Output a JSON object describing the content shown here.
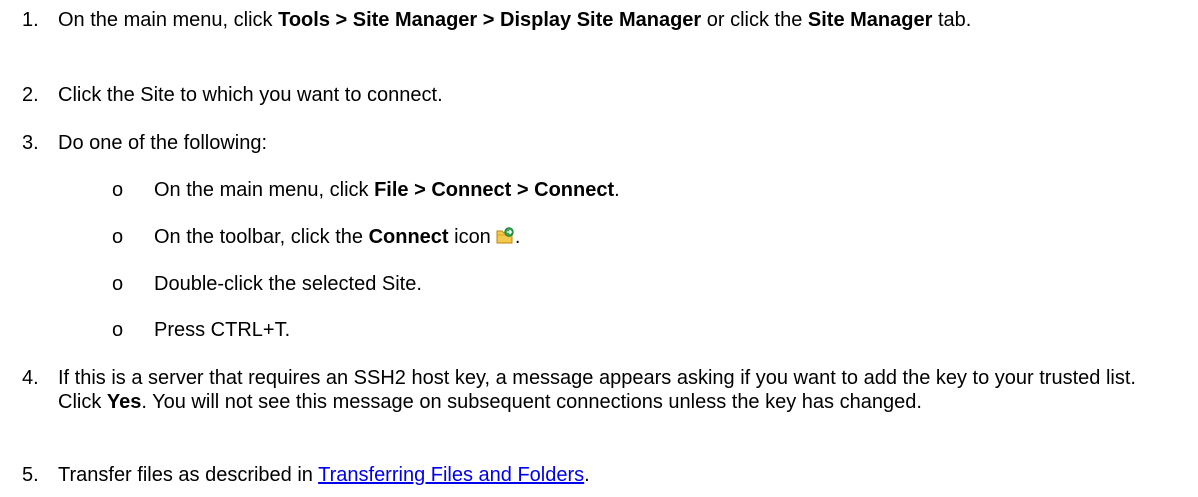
{
  "steps": [
    {
      "number": "1.",
      "parts": [
        "On the main menu, click ",
        "Tools > Site Manager > Display Site Manager",
        " or click the ",
        "Site Manager",
        " tab."
      ]
    },
    {
      "number": "2.",
      "text": "Click the Site to which you want to connect."
    },
    {
      "number": "3.",
      "text": "Do one of the following:",
      "options": [
        {
          "bullet": "o",
          "parts": [
            "On the main menu, click ",
            "File > Connect > Connect",
            "."
          ]
        },
        {
          "bullet": "o",
          "parts": [
            "On the toolbar, click the ",
            "Connect",
            " icon",
            "."
          ],
          "icon": "connect-folder-icon"
        },
        {
          "bullet": "o",
          "text": "Double-click the selected Site."
        },
        {
          "bullet": "o",
          "text": "Press CTRL+T."
        }
      ]
    },
    {
      "number": "4.",
      "parts": [
        "If this is a server that requires an SSH2 host key, a message appears asking if you want to add the key to your trusted list. Click ",
        "Yes",
        ". You will not see this message on subsequent connections unless the key has changed."
      ]
    },
    {
      "number": "5.",
      "parts": [
        "Transfer files as described in ",
        "Transferring Files and Folders",
        "."
      ]
    }
  ],
  "colors": {
    "link": "#0000ee",
    "text": "#000000"
  }
}
